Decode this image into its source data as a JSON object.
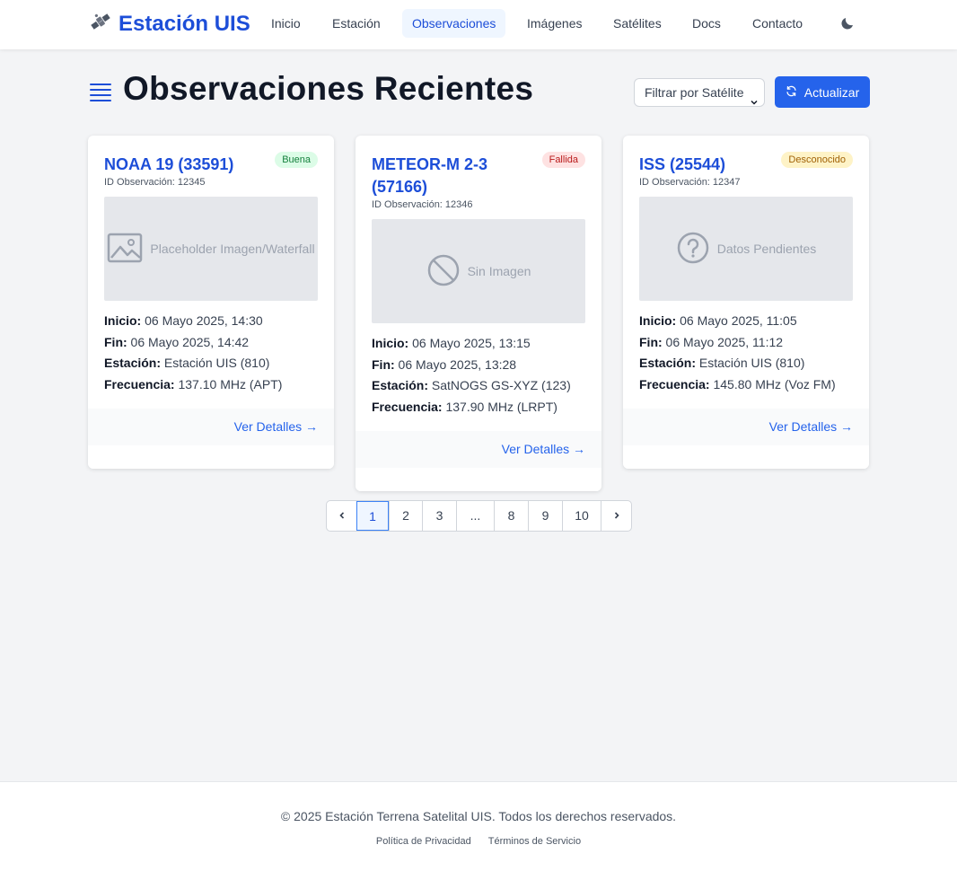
{
  "nav": {
    "brand": "Estación UIS",
    "links": [
      "Inicio",
      "Estación",
      "Observaciones",
      "Imágenes",
      "Satélites",
      "Docs",
      "Contacto"
    ],
    "active": "Observaciones"
  },
  "page": {
    "title": "Observaciones Recientes",
    "filter_label": "Filtrar por Satélite",
    "refresh_label": "Actualizar"
  },
  "labels": {
    "start": "Inicio:",
    "end": "Fin:",
    "station": "Estación:",
    "frequency": "Frecuencia:",
    "details_link": "Ver Detalles →"
  },
  "cards": [
    {
      "name": "NOAA 19 (33591)",
      "obs_id": "ID Observación: 12345",
      "status": "Buena",
      "thumb_text": "Placeholder Imagen/Waterfall",
      "start": "06 Mayo 2025, 14:30",
      "end": "06 Mayo 2025, 14:42",
      "station": "Estación UIS (810)",
      "frequency": "137.10 MHz (APT)"
    },
    {
      "name": "METEOR-M 2-3 (57166)",
      "obs_id": "ID Observación: 12346",
      "status": "Fallida",
      "thumb_text": "Sin Imagen",
      "start": "06 Mayo 2025, 13:15",
      "end": "06 Mayo 2025, 13:28",
      "station": "SatNOGS GS-XYZ (123)",
      "frequency": "137.90 MHz (LRPT)"
    },
    {
      "name": "ISS (25544)",
      "obs_id": "ID Observación: 12347",
      "status": "Desconocido",
      "thumb_text": "Datos Pendientes",
      "start": "06 Mayo 2025, 11:05",
      "end": "06 Mayo 2025, 11:12",
      "station": "Estación UIS (810)",
      "frequency": "145.80 MHz (Voz FM)"
    }
  ],
  "pagination": {
    "pages": [
      "1",
      "2",
      "3",
      "...",
      "8",
      "9",
      "10"
    ],
    "current": "1"
  },
  "footer": {
    "copyright": "© 2025 Estación Terrena Satelital UIS. Todos los derechos reservados.",
    "links": [
      "Política de Privacidad",
      "Términos de Servicio"
    ]
  },
  "colors": {
    "brand": "#1d4ed8",
    "primary_button": "#2563eb",
    "badge_good": "#dcfce7",
    "badge_fail": "#fee2e2",
    "badge_unknown": "#fef3c7"
  },
  "icons": {
    "brand": "satellite-icon",
    "theme_toggle": "moon-icon",
    "title": "list-icon",
    "refresh": "refresh-icon",
    "thumb_1": "image-icon",
    "thumb_2": "no-image-icon",
    "thumb_3": "question-icon"
  }
}
